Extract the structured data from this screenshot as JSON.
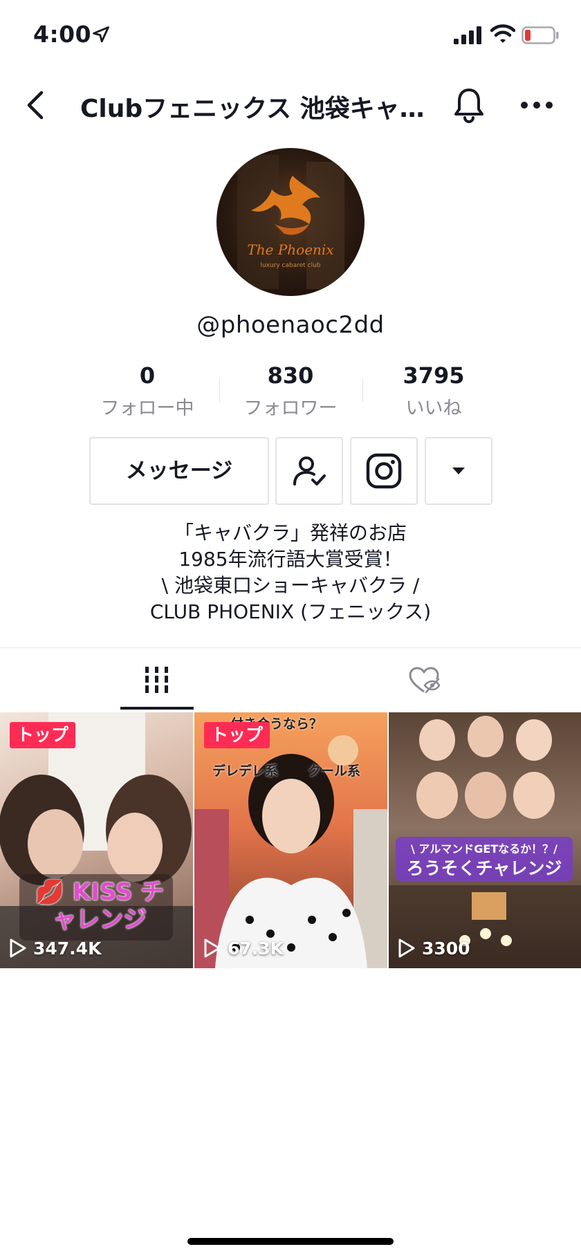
{
  "status_bar": {
    "time": "4:00",
    "icons": [
      "location-arrow-icon",
      "cellular-signal-icon",
      "wifi-icon",
      "battery-low-icon"
    ],
    "battery_color": "#e53935"
  },
  "header": {
    "title": "Clubフェニックス 池袋キャ…",
    "icons": [
      "back-chevron-icon",
      "bell-icon",
      "more-dots-icon"
    ]
  },
  "profile": {
    "avatar_alt": "The Phoenix luxury cabaret club",
    "avatar_logo_text": "The Phoenix",
    "avatar_logo_subtext": "luxury cabaret club",
    "username": "@phoenaoc2dd"
  },
  "stats": [
    {
      "value": "0",
      "label": "フォロー中"
    },
    {
      "value": "830",
      "label": "フォロワー"
    },
    {
      "value": "3795",
      "label": "いいね"
    }
  ],
  "actions": {
    "message_label": "メッセージ",
    "icons": [
      "user-check-icon",
      "instagram-icon",
      "dropdown-triangle-icon"
    ]
  },
  "bio": [
    "「キャバクラ」発祥のお店",
    "1985年流行語大賞受賞！",
    "\\ 池袋東口ショーキャバクラ /",
    "CLUB PHOENIX (フェニックス)"
  ],
  "tabs": [
    {
      "name": "videos",
      "icon": "grid-bars-icon",
      "active": true
    },
    {
      "name": "liked",
      "icon": "heart-hidden-icon",
      "active": false
    }
  ],
  "videos": [
    {
      "badge": "トップ",
      "views": "347.4K",
      "overlay": "💋 KISS チャレンジ"
    },
    {
      "badge": "トップ",
      "views": "67.3K",
      "overlay_top": "付き合うなら？",
      "overlay_left": "デレデレ系",
      "overlay_right": "クール系"
    },
    {
      "badge": "",
      "views": "3300",
      "overlay_top": "\\ アルマンドGETなるか！？/",
      "overlay_main": "ろうそくチャレンジ"
    }
  ],
  "colors": {
    "accent_red": "#fe2c55",
    "text_primary": "#161823",
    "text_secondary": "#8a8b91",
    "border": "#e3e3e4"
  }
}
